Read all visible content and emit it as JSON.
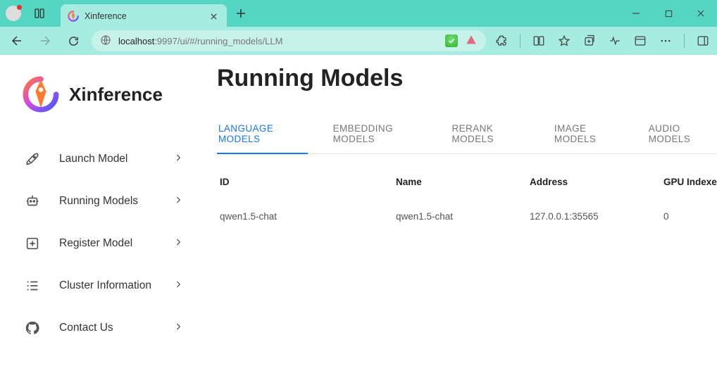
{
  "browser": {
    "tab_title": "Xinference",
    "url_host": "localhost",
    "url_port": ":9997",
    "url_path": "/ui/#/running_models/LLM"
  },
  "brand": {
    "name": "Xinference"
  },
  "sidebar": {
    "items": [
      {
        "label": "Launch Model"
      },
      {
        "label": "Running Models"
      },
      {
        "label": "Register Model"
      },
      {
        "label": "Cluster Information"
      },
      {
        "label": "Contact Us"
      }
    ]
  },
  "page": {
    "title": "Running Models",
    "tabs": [
      {
        "label": "LANGUAGE MODELS",
        "active": true
      },
      {
        "label": "EMBEDDING MODELS"
      },
      {
        "label": "RERANK MODELS"
      },
      {
        "label": "IMAGE MODELS"
      },
      {
        "label": "AUDIO MODELS"
      }
    ],
    "table": {
      "headers": {
        "id": "ID",
        "name": "Name",
        "address": "Address",
        "gpu": "GPU Indexes"
      },
      "rows": [
        {
          "id": "qwen1.5-chat",
          "name": "qwen1.5-chat",
          "address": "127.0.0.1:35565",
          "gpu": "0"
        }
      ]
    }
  }
}
